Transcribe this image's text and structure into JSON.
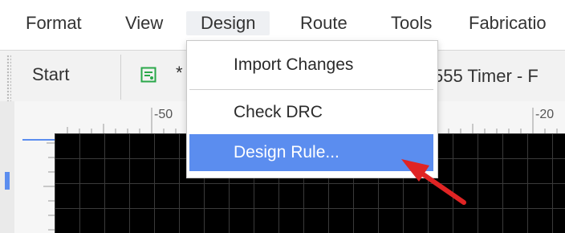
{
  "menubar": {
    "items": [
      "Format",
      "View",
      "Design",
      "Route",
      "Tools",
      "Fabricatio"
    ],
    "active": "Design"
  },
  "tabbar": {
    "start_label": "Start",
    "tab_prefix": "*",
    "tab_title": "555 Timer - F"
  },
  "ruler": {
    "top_labels": [
      "-50",
      "-20"
    ]
  },
  "dropdown": {
    "items": [
      {
        "label": "Import Changes",
        "highlighted": false
      },
      {
        "label": "Check DRC",
        "highlighted": false
      },
      {
        "label": "Design Rule...",
        "highlighted": true
      }
    ]
  },
  "colors": {
    "highlight": "#5b8def",
    "canvas": "#000000",
    "annotation": "#e02424"
  },
  "icons": {
    "tab_icon": "pcb-document-icon"
  }
}
